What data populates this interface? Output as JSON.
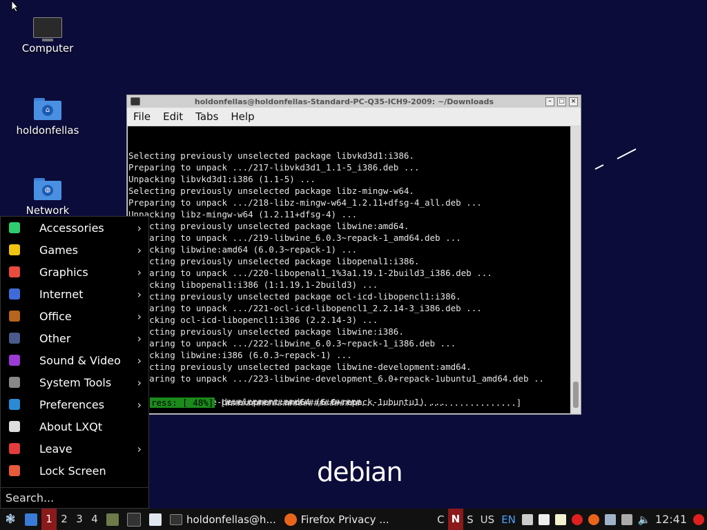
{
  "desktop": {
    "icons": [
      {
        "label": "Computer"
      },
      {
        "label": "holdonfellas"
      },
      {
        "label": "Network"
      }
    ],
    "logo": "debian"
  },
  "terminal": {
    "title": "holdonfellas@holdonfellas-Standard-PC-Q35-ICH9-2009: ~/Downloads",
    "menu": [
      "File",
      "Edit",
      "Tabs",
      "Help"
    ],
    "lines": [
      "Selecting previously unselected package libvkd3d1:i386.",
      "Preparing to unpack .../217-libvkd3d1_1.1-5_i386.deb ...",
      "Unpacking libvkd3d1:i386 (1.1-5) ...",
      "Selecting previously unselected package libz-mingw-w64.",
      "Preparing to unpack .../218-libz-mingw-w64_1.2.11+dfsg-4_all.deb ...",
      "Unpacking libz-mingw-w64 (1.2.11+dfsg-4) ...",
      "Selecting previously unselected package libwine:amd64.",
      "Preparing to unpack .../219-libwine_6.0.3~repack-1_amd64.deb ...",
      "Unpacking libwine:amd64 (6.0.3~repack-1) ...",
      "Selecting previously unselected package libopenal1:i386.",
      "Preparing to unpack .../220-libopenal1_1%3a1.19.1-2build3_i386.deb ...",
      "Unpacking libopenal1:i386 (1:1.19.1-2build3) ...",
      "Selecting previously unselected package ocl-icd-libopencl1:i386.",
      "Preparing to unpack .../221-ocl-icd-libopencl1_2.2.14-3_i386.deb ...",
      "Unpacking ocl-icd-libopencl1:i386 (2.2.14-3) ...",
      "Selecting previously unselected package libwine:i386.",
      "Preparing to unpack .../222-libwine_6.0.3~repack-1_i386.deb ...",
      "Unpacking libwine:i386 (6.0.3~repack-1) ...",
      "Selecting previously unselected package libwine-development:amd64.",
      "Preparing to unpack .../223-libwine-development_6.0+repack-1ubuntu1_amd64.deb ..",
      "",
      "Unpacking libwine-development:amd64 (6.0+repack-1ubuntu1) ..."
    ],
    "progress_label": "ress: [ 48%]",
    "progress_bar": " [##########################..............................]",
    "progress_percent": 48
  },
  "start_menu": {
    "items": [
      {
        "label": "Accessories",
        "submenu": true,
        "icon": "accessories-icon",
        "color": "#2ecc71"
      },
      {
        "label": "Games",
        "submenu": true,
        "icon": "games-icon",
        "color": "#f1c40f"
      },
      {
        "label": "Graphics",
        "submenu": true,
        "icon": "graphics-icon",
        "color": "#e74c3c"
      },
      {
        "label": "Internet",
        "submenu": true,
        "icon": "internet-icon",
        "color": "#3f6bd8"
      },
      {
        "label": "Office",
        "submenu": true,
        "icon": "office-icon",
        "color": "#b5651d"
      },
      {
        "label": "Other",
        "submenu": true,
        "icon": "other-icon",
        "color": "#4a5a8a"
      },
      {
        "label": "Sound & Video",
        "submenu": true,
        "icon": "sound-video-icon",
        "color": "#9b3bd6"
      },
      {
        "label": "System Tools",
        "submenu": true,
        "icon": "system-tools-icon",
        "color": "#888888"
      },
      {
        "label": "Preferences",
        "submenu": true,
        "icon": "preferences-icon",
        "color": "#2a8ad4"
      },
      {
        "label": "About LXQt",
        "submenu": false,
        "icon": "info-icon",
        "color": "#dddddd"
      },
      {
        "label": "Leave",
        "submenu": true,
        "icon": "power-icon",
        "color": "#e23c3c"
      },
      {
        "label": "Lock Screen",
        "submenu": false,
        "icon": "lock-icon",
        "color": "#e85a3a"
      }
    ],
    "search_placeholder": "Search..."
  },
  "taskbar": {
    "desktops": [
      "1",
      "2",
      "3",
      "4"
    ],
    "active_desktop": "1",
    "tasks": [
      {
        "label": "holdonfellas@h...",
        "icon": "terminal-icon"
      },
      {
        "label": "Firefox Privacy ...",
        "icon": "firefox-icon"
      }
    ],
    "keyboard": {
      "c": "C",
      "n": "N",
      "s": "S",
      "layout": "US",
      "lang": "EN"
    },
    "clock": "12:41"
  }
}
